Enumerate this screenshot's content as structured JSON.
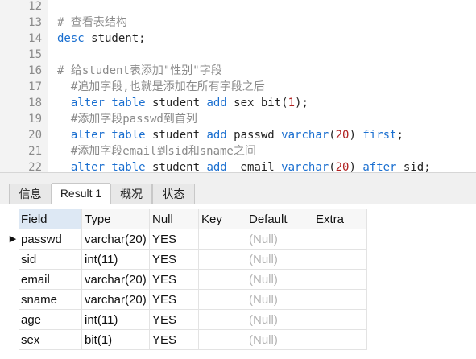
{
  "editor": {
    "lines": [
      {
        "n": "12",
        "indent": "",
        "tokens": []
      },
      {
        "n": "13",
        "indent": "",
        "tokens": [
          {
            "t": "c",
            "v": "# 查看表结构"
          }
        ]
      },
      {
        "n": "14",
        "indent": "",
        "tokens": [
          {
            "t": "k",
            "v": "desc"
          },
          {
            "t": "x",
            "v": " student;"
          }
        ]
      },
      {
        "n": "15",
        "indent": "",
        "tokens": []
      },
      {
        "n": "16",
        "indent": "",
        "tokens": [
          {
            "t": "c",
            "v": "# 给student表添加\"性别\"字段"
          }
        ]
      },
      {
        "n": "17",
        "indent": "  ",
        "tokens": [
          {
            "t": "c",
            "v": "#追加字段,也就是添加在所有字段之后"
          }
        ]
      },
      {
        "n": "18",
        "indent": "  ",
        "tokens": [
          {
            "t": "k",
            "v": "alter table"
          },
          {
            "t": "x",
            "v": " student "
          },
          {
            "t": "k",
            "v": "add"
          },
          {
            "t": "x",
            "v": " sex bit("
          },
          {
            "t": "n",
            "v": "1"
          },
          {
            "t": "x",
            "v": ");"
          }
        ]
      },
      {
        "n": "19",
        "indent": "  ",
        "tokens": [
          {
            "t": "c",
            "v": "#添加字段passwd到首列"
          }
        ]
      },
      {
        "n": "20",
        "indent": "  ",
        "tokens": [
          {
            "t": "k",
            "v": "alter table"
          },
          {
            "t": "x",
            "v": " student "
          },
          {
            "t": "k",
            "v": "add"
          },
          {
            "t": "x",
            "v": " passwd "
          },
          {
            "t": "k",
            "v": "varchar"
          },
          {
            "t": "x",
            "v": "("
          },
          {
            "t": "n",
            "v": "20"
          },
          {
            "t": "x",
            "v": ") "
          },
          {
            "t": "k",
            "v": "first"
          },
          {
            "t": "x",
            "v": ";"
          }
        ]
      },
      {
        "n": "21",
        "indent": "  ",
        "tokens": [
          {
            "t": "c",
            "v": "#添加字段email到sid和sname之间"
          }
        ]
      },
      {
        "n": "22",
        "indent": "  ",
        "tokens": [
          {
            "t": "k",
            "v": "alter table"
          },
          {
            "t": "x",
            "v": " student "
          },
          {
            "t": "k",
            "v": "add"
          },
          {
            "t": "x",
            "v": "  email "
          },
          {
            "t": "k",
            "v": "varchar"
          },
          {
            "t": "x",
            "v": "("
          },
          {
            "t": "n",
            "v": "20"
          },
          {
            "t": "x",
            "v": ") "
          },
          {
            "t": "k",
            "v": "after"
          },
          {
            "t": "x",
            "v": " sid;"
          }
        ]
      }
    ]
  },
  "tabs": [
    {
      "label": "信息",
      "active": false
    },
    {
      "label": "Result 1",
      "active": true
    },
    {
      "label": "概况",
      "active": false
    },
    {
      "label": "状态",
      "active": false
    }
  ],
  "grid": {
    "columns": [
      "Field",
      "Type",
      "Null",
      "Key",
      "Default",
      "Extra"
    ],
    "rows": [
      [
        "passwd",
        "varchar(20)",
        "YES",
        "",
        "(Null)",
        ""
      ],
      [
        "sid",
        "int(11)",
        "YES",
        "",
        "(Null)",
        ""
      ],
      [
        "email",
        "varchar(20)",
        "YES",
        "",
        "(Null)",
        ""
      ],
      [
        "sname",
        "varchar(20)",
        "YES",
        "",
        "(Null)",
        ""
      ],
      [
        "age",
        "int(11)",
        "YES",
        "",
        "(Null)",
        ""
      ],
      [
        "sex",
        "bit(1)",
        "YES",
        "",
        "(Null)",
        ""
      ]
    ],
    "current_row_marker": "▶"
  },
  "colors": {
    "keyword": "#1a6fd0",
    "comment": "#8a8a8a",
    "number": "#b02020",
    "null_text": "#b4b4b4",
    "header_selected": "#dde8f4"
  }
}
